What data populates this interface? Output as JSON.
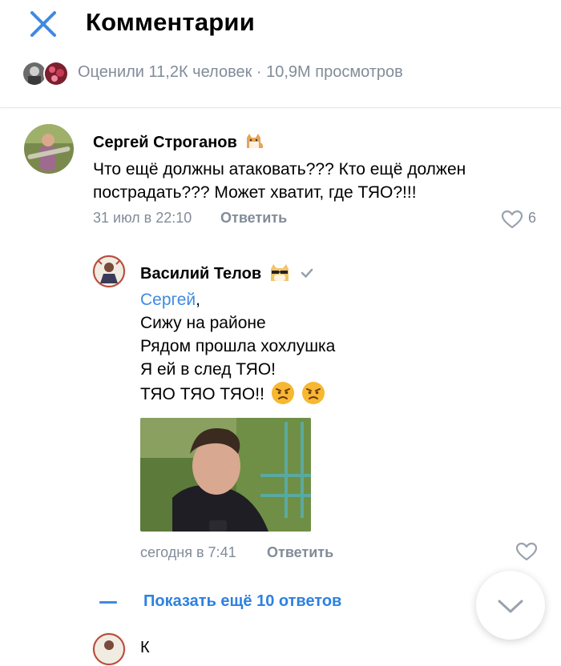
{
  "header": {
    "title": "Комментарии",
    "close_icon": "close-icon"
  },
  "stats": {
    "text": "Оценили 11,2К человек · 10,9М просмотров"
  },
  "comments": [
    {
      "author": "Сергей Строганов",
      "author_emoji": "cat-icon",
      "text_line1": "Что ещё должны атаковать??? Кто ещё должен",
      "text_line2": "пострадать??? Может хватит, где ТЯО?!!!",
      "time": "31 июл в 22:10",
      "reply_label": "Ответить",
      "likes": "6"
    },
    {
      "author": "Василий Телов",
      "author_emoji": "cool-dog-icon",
      "verified_icon": "check-icon",
      "mention": "Сергей",
      "mention_suffix": ",",
      "line2": "Сижу на районе",
      "line3": "Рядом прошла хохлушка",
      "line4": "Я ей в след ТЯО!",
      "line5": "ТЯО ТЯО ТЯО!!",
      "line5_emojis": [
        "angry-face-icon",
        "angry-face-icon"
      ],
      "time": "сегодня в 7:41",
      "reply_label": "Ответить"
    }
  ],
  "show_more": {
    "label": "Показать ещё 10 ответов"
  },
  "next_comment": {
    "author": "К"
  },
  "colors": {
    "accent": "#3f8ae0",
    "secondary_text": "#818c99",
    "divider": "#e7e8ec"
  }
}
